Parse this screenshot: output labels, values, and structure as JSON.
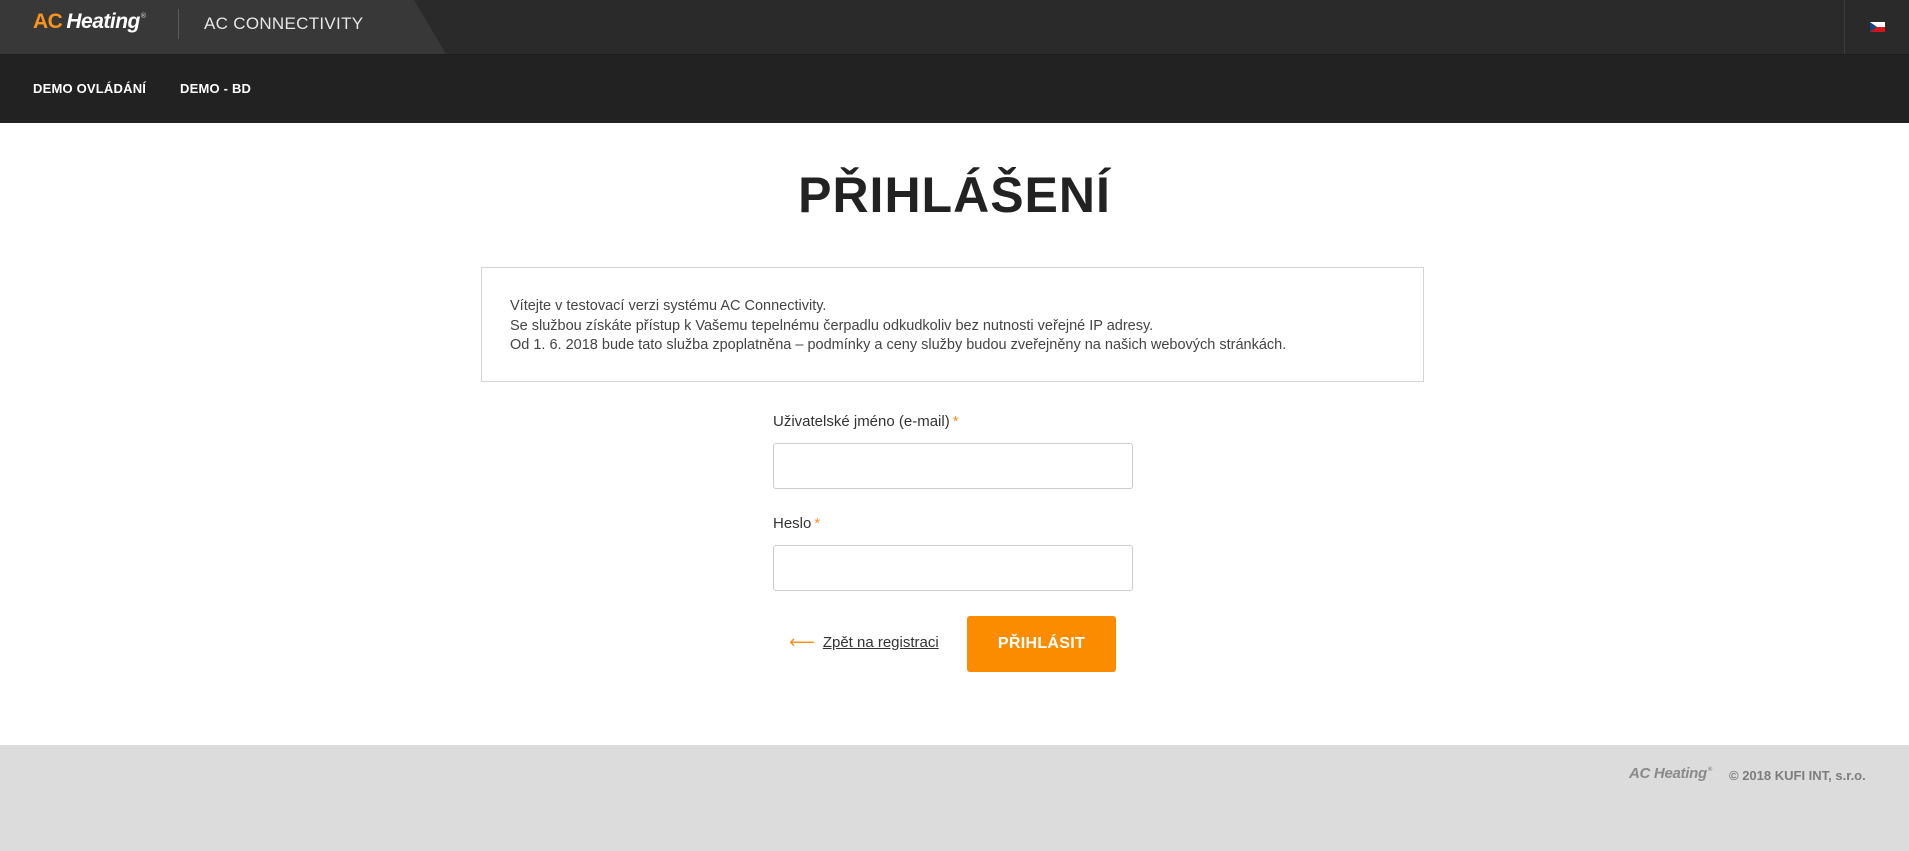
{
  "header": {
    "logo_ac": "AC",
    "logo_heating": "Heating",
    "logo_reg": "®",
    "app_title": "AC CONNECTIVITY",
    "language_flag": "cz-flag-icon"
  },
  "nav": {
    "items": [
      {
        "label": "DEMO OVLÁDÁNÍ"
      },
      {
        "label": "DEMO - BD"
      }
    ]
  },
  "main": {
    "title": "PŘIHLÁŠENÍ",
    "info_lines": [
      "Vítejte v testovací verzi systému AC Connectivity.",
      "Se službou získáte přístup k Vašemu tepelnému čerpadlu odkudkoliv bez nutnosti veřejné IP adresy.",
      "Od 1. 6. 2018 bude tato služba zpoplatněna – podmínky a ceny služby budou zveřejněny na našich webových stránkách."
    ],
    "form": {
      "username_label": "Uživatelské jméno (e-mail)",
      "username_value": "",
      "password_label": "Heslo",
      "password_value": "",
      "required_mark": "*",
      "back_link": "Zpět na registraci",
      "back_arrow": "⟵",
      "submit_label": "PŘIHLÁSIT"
    }
  },
  "footer": {
    "logo": "AC Heating",
    "logo_reg": "®",
    "copyright": "© 2018 KUFI INT, s.r.o."
  },
  "colors": {
    "accent": "#fb8c00",
    "topbar": "#2a2a2a",
    "navbar": "#222222",
    "footer": "#dcdcdc"
  }
}
